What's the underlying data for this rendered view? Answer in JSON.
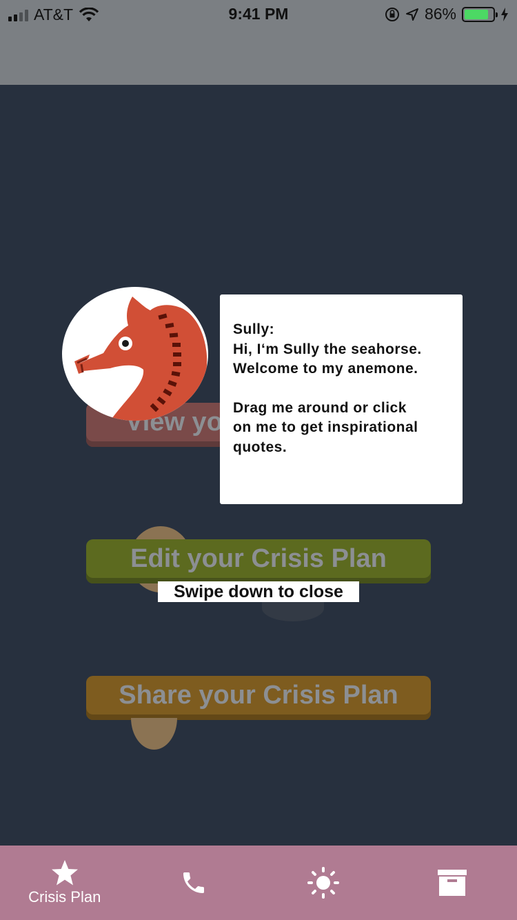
{
  "status_bar": {
    "carrier": "AT&T",
    "time": "9:41 PM",
    "battery_percent": "86%",
    "battery_level": 0.86
  },
  "buttons": {
    "view": "View your Crisis Plan",
    "edit": "Edit your Crisis Plan",
    "share": "Share your Crisis Plan"
  },
  "speech": {
    "line1": "Sully:",
    "line2": "Hi, I‘m Sully the seahorse.",
    "line3": "Welcome to my anemone.",
    "line4": "Drag me around or click",
    "line5": "on me to get inspirational",
    "line6": "quotes."
  },
  "swipe_hint": "Swipe down to close",
  "tabs": [
    {
      "label": "Crisis Plan",
      "icon": "star-icon",
      "active": true
    },
    {
      "label": "",
      "icon": "phone-icon"
    },
    {
      "label": "",
      "icon": "sun-icon"
    },
    {
      "label": "",
      "icon": "archive-icon"
    }
  ],
  "colors": {
    "background": "#27303e",
    "tabbar": "#b07b92",
    "seahorse": "#d14f36",
    "view_button": "#7a4a49",
    "edit_button": "#5c6a1f",
    "share_button": "#7e5c1f"
  }
}
